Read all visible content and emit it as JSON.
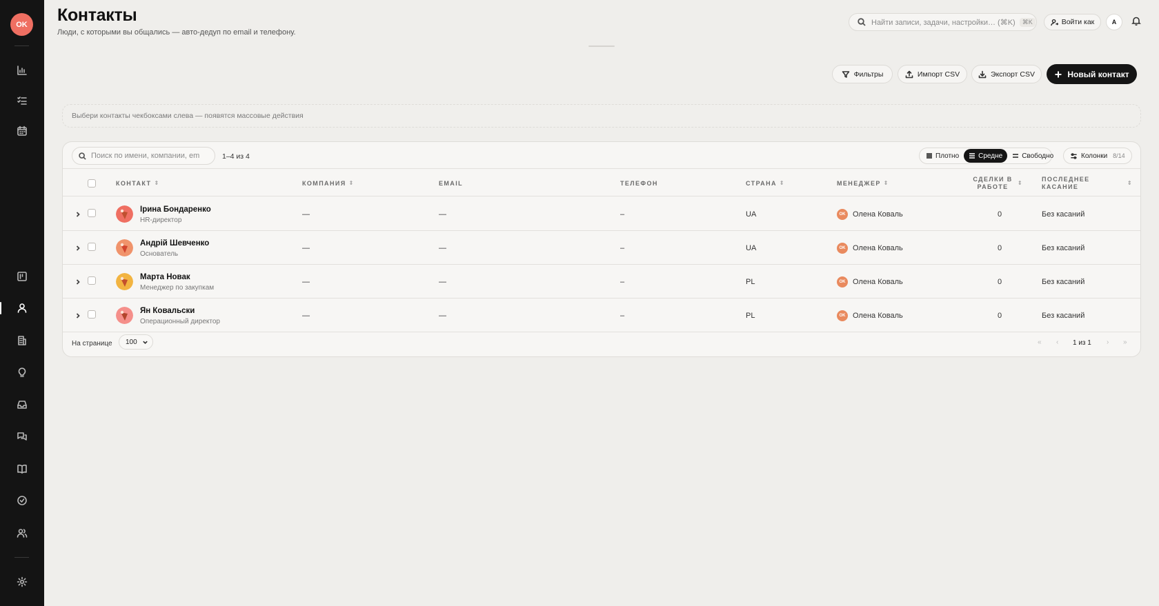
{
  "sidebar": {
    "avatar_initials": "OK",
    "icons": [
      "chart-icon",
      "tasks-icon",
      "calendar-icon",
      "board-icon",
      "contacts-icon",
      "companies-icon",
      "ideas-icon",
      "inbox-icon",
      "chats-icon",
      "knowledge-icon",
      "done-icon",
      "team-icon",
      "settings-icon"
    ],
    "active": "contacts-icon"
  },
  "header": {
    "title": "Контакты",
    "subtitle": "Люди, с которыми вы общались — авто-дедуп по email и телефону."
  },
  "top_bar": {
    "search_placeholder": "Найти записи, задачи, настройки… (⌘K)",
    "shortcut": "⌘K",
    "login_as": "Войти как",
    "user_initial": "A"
  },
  "actions": {
    "filters": "Фильтры",
    "import_csv": "Импорт CSV",
    "export_csv": "Экспорт CSV",
    "new_contact": "Новый контакт"
  },
  "bulk_hint": "Выбери контакты чекбоксами слева — появятся массовые действия",
  "table": {
    "search_placeholder": "Поиск по имени, компании, em",
    "range": "1–4 из 4",
    "density": {
      "compact": "Плотно",
      "medium": "Средне",
      "loose": "Свободно",
      "selected": "Средне"
    },
    "columns_label": "Колонки",
    "columns_count": "8/14",
    "headers": {
      "contact": "КОНТАКТ",
      "company": "КОМПАНИЯ",
      "email": "EMAIL",
      "phone": "ТЕЛЕФОН",
      "country": "СТРАНА",
      "manager": "МЕНЕДЖЕР",
      "deals": "СДЕЛКИ В РАБОТЕ",
      "last_touch": "ПОСЛЕДНЕЕ КАСАНИЕ"
    },
    "rows": [
      {
        "name": "Ірина Бондаренко",
        "role": "HR-директор",
        "company": "—",
        "email": "—",
        "phone": "–",
        "country": "UA",
        "manager_initials": "OK",
        "manager": "Олена Коваль",
        "deals": "0",
        "last_touch": "Без касаний",
        "avatar_colors": [
          "#ef6f62",
          "#c0502f"
        ]
      },
      {
        "name": "Андрій Шевченко",
        "role": "Основатель",
        "company": "—",
        "email": "—",
        "phone": "–",
        "country": "UA",
        "manager_initials": "OK",
        "manager": "Олена Коваль",
        "deals": "0",
        "last_touch": "Без касаний",
        "avatar_colors": [
          "#f0936b",
          "#d2452f"
        ]
      },
      {
        "name": "Марта Новак",
        "role": "Менеджер по закупкам",
        "company": "—",
        "email": "—",
        "phone": "–",
        "country": "PL",
        "manager_initials": "OK",
        "manager": "Олена Коваль",
        "deals": "0",
        "last_touch": "Без касаний",
        "avatar_colors": [
          "#f2b441",
          "#c3502c"
        ]
      },
      {
        "name": "Ян Ковальски",
        "role": "Операционный директор",
        "company": "—",
        "email": "—",
        "phone": "–",
        "country": "PL",
        "manager_initials": "OK",
        "manager": "Олена Коваль",
        "deals": "0",
        "last_touch": "Без касаний",
        "avatar_colors": [
          "#f58f8a",
          "#b2452c"
        ]
      }
    ],
    "footer": {
      "per_page_label": "На странице",
      "per_page_value": "100",
      "page_text": "1 из 1"
    }
  }
}
